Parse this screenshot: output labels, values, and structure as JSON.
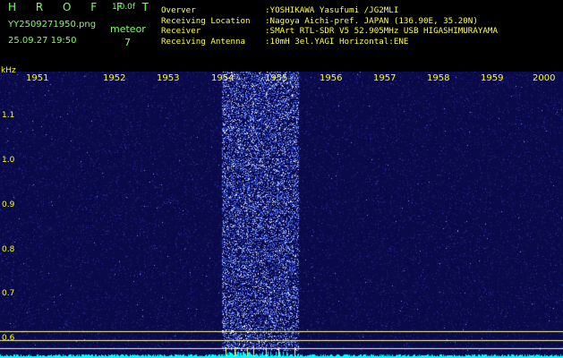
{
  "header": {
    "logo": "H R O F F T",
    "version": "1.0.0f",
    "filename": "YY2509271950.png",
    "timestamp": "25.09.27 19:50",
    "detection_type": "meteor",
    "detection_count": "7"
  },
  "info": [
    {
      "key": "Overver",
      "value": ":YOSHIKAWA Yasufumi /JG2MLI"
    },
    {
      "key": "Receiving Location",
      "value": ":Nagoya Aichi-pref. JAPAN (136.90E, 35.20N)"
    },
    {
      "key": "Receiver",
      "value": ":SMArt RTL-SDR V5 52.905MHz USB HIGASHIMURAYAMA"
    },
    {
      "key": "Receiving Antenna",
      "value": ":10mH 3el.YAGI Horizontal:ENE"
    }
  ],
  "axis": {
    "unit": "kHz",
    "y_ticks": [
      "1.1",
      "1.0",
      "0.9",
      "0.8",
      "0.7",
      "0.6"
    ],
    "x_ticks": [
      "1951",
      "1952",
      "1953",
      "1954",
      "1955",
      "1956",
      "1957",
      "1958",
      "1959",
      "2000"
    ]
  },
  "colors": {
    "text_green": "#7dff64",
    "label_yellow": "#ffff00",
    "info_yellow": "#ffff46",
    "plot_bg": "#0a0a4a",
    "highlight": "#2d3fc8",
    "baseline": "#00ffff",
    "guide_line": "#ffff8c"
  }
}
